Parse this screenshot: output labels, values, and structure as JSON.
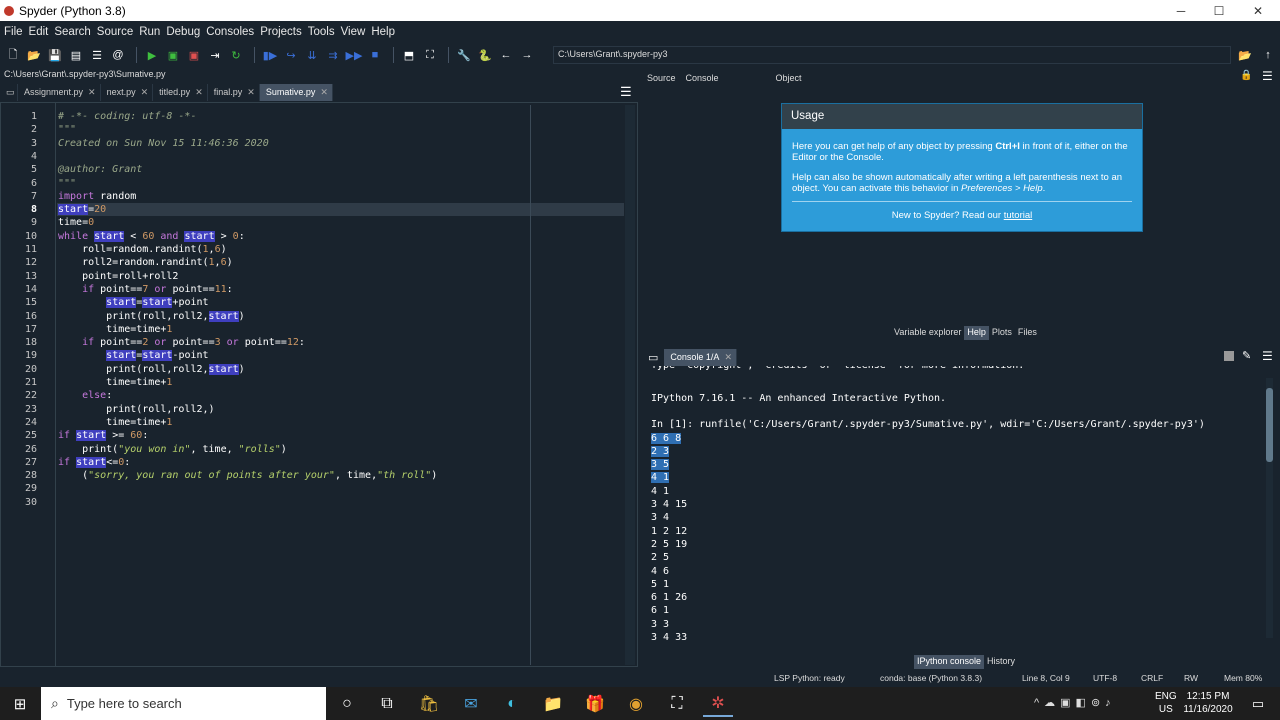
{
  "window": {
    "title": "Spyder (Python 3.8)",
    "min": "─",
    "max": "☐",
    "close": "✕"
  },
  "menu": [
    "File",
    "Edit",
    "Search",
    "Source",
    "Run",
    "Debug",
    "Consoles",
    "Projects",
    "Tools",
    "View",
    "Help"
  ],
  "toolbar": {
    "path": "C:\\Users\\Grant\\.spyder-py3"
  },
  "editor": {
    "file_path": "C:\\Users\\Grant\\.spyder-py3\\Sumative.py",
    "tabs": [
      {
        "label": "Assignment.py"
      },
      {
        "label": "next.py"
      },
      {
        "label": "titled.py"
      },
      {
        "label": "final.py"
      },
      {
        "label": "Sumative.py"
      }
    ],
    "line_numbers": [
      "1",
      "2",
      "3",
      "4",
      "5",
      "6",
      "7",
      "8",
      "9",
      "10",
      "11",
      "12",
      "13",
      "14",
      "15",
      "16",
      "17",
      "18",
      "19",
      "20",
      "21",
      "22",
      "23",
      "24",
      "25",
      "26",
      "27",
      "28",
      "29",
      "30"
    ]
  },
  "help": {
    "source_label": "Source",
    "source_value": "Console",
    "object_label": "Object",
    "usage_title": "Usage",
    "usage_p1a": "Here you can get help of any object by pressing ",
    "usage_p1b": "Ctrl+I",
    "usage_p1c": " in front of it, either on the Editor or the Console.",
    "usage_p2a": "Help can also be shown automatically after writing a left parenthesis next to an object. You can activate this behavior in ",
    "usage_p2b": "Preferences > Help",
    "usage_p2c": ".",
    "new_text": "New to Spyder? Read our ",
    "tutorial": "tutorial",
    "pane_tabs": [
      "Variable explorer",
      "Help",
      "Plots",
      "Files"
    ]
  },
  "console": {
    "tab": "Console 1/A",
    "bottom_tabs": [
      "IPython console",
      "History"
    ],
    "lines": [
      "Type \"copyright\", \"credits\" or \"license\" for more information.",
      "",
      "IPython 7.16.1 -- An enhanced Interactive Python.",
      "",
      "In [1]: runfile('C:/Users/Grant/.spyder-py3/Sumative.py', wdir='C:/Users/Grant/.spyder-py3')",
      "6 6 8",
      "2 3",
      "3 5",
      "4 1",
      "4 1",
      "3 4 15",
      "3 4",
      "1 2 12",
      "2 5 19",
      "2 5",
      "4 6",
      "5 1",
      "6 1 26",
      "6 1",
      "3 3",
      "3 4 33"
    ]
  },
  "status": {
    "lsp": "LSP Python: ready",
    "conda": "conda: base (Python 3.8.3)",
    "position": "Line 8, Col 9",
    "encoding": "UTF-8",
    "eol": "CRLF",
    "rw": "RW",
    "mem": "Mem 80%"
  },
  "taskbar": {
    "search_placeholder": "Type here to search",
    "lang1": "ENG",
    "lang2": "US",
    "time": "12:15 PM",
    "date": "11/16/2020"
  }
}
